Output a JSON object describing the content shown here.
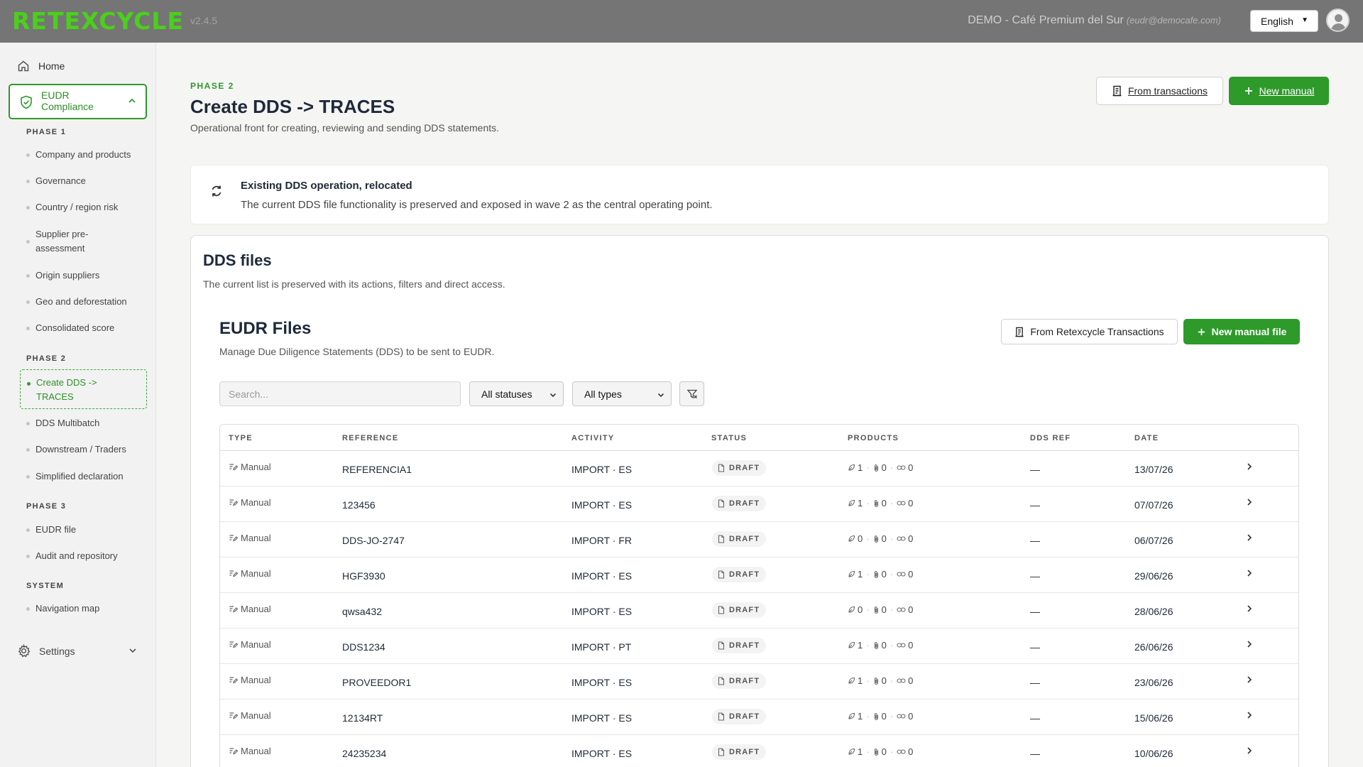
{
  "topbar": {
    "logo": "RETEXCYCLE",
    "version": "v2.4.5",
    "tenant": "DEMO - Café Premium del Sur",
    "email": "(eudr@democafe.com)",
    "language": "English"
  },
  "sidebar": {
    "home": "Home",
    "eudr": "EUDR Compliance",
    "phase1": {
      "title": "PHASE 1",
      "items": [
        "Company and products",
        "Governance",
        "Country / region risk",
        "Supplier pre-assessment",
        "Origin suppliers",
        "Geo and deforestation",
        "Consolidated score"
      ]
    },
    "phase2": {
      "title": "PHASE 2",
      "items": [
        "Create DDS -> TRACES",
        "DDS Multibatch",
        "Downstream / Traders",
        "Simplified declaration"
      ]
    },
    "phase3": {
      "title": "PHASE 3",
      "items": [
        "EUDR file",
        "Audit and repository"
      ]
    },
    "system": {
      "title": "SYSTEM",
      "items": [
        "Navigation map"
      ]
    },
    "settings": "Settings"
  },
  "header": {
    "phase": "PHASE 2",
    "title": "Create DDS -> TRACES",
    "subtitle": "Operational front for creating, reviewing and sending DDS statements.",
    "btn_transactions": "From transactions",
    "btn_new_manual": "New manual"
  },
  "notice": {
    "title": "Existing DDS operation, relocated",
    "text": "The current DDS file functionality is preserved and exposed in wave 2 as the central operating point."
  },
  "dds_card": {
    "title": "DDS files",
    "subtitle": "The current list is preserved with its actions, filters and direct access."
  },
  "files": {
    "title": "EUDR Files",
    "subtitle": "Manage Due Diligence Statements (DDS) to be sent to EUDR.",
    "btn_retexcycle": "From Retexcycle Transactions",
    "btn_new_file": "New manual file",
    "search_placeholder": "Search...",
    "status_filter": "All statuses",
    "type_filter": "All types"
  },
  "table": {
    "headers": [
      "TYPE",
      "REFERENCE",
      "ACTIVITY",
      "STATUS",
      "PRODUCTS",
      "DDS REF",
      "DATE"
    ],
    "rows": [
      {
        "type": "Manual",
        "reference": "REFERENCIA1",
        "activity": "IMPORT · ES",
        "status": "DRAFT",
        "p1": "1",
        "p2": "0",
        "p3": "0",
        "dds_ref": "—",
        "date": "13/07/26"
      },
      {
        "type": "Manual",
        "reference": "123456",
        "activity": "IMPORT · ES",
        "status": "DRAFT",
        "p1": "1",
        "p2": "0",
        "p3": "0",
        "dds_ref": "—",
        "date": "07/07/26"
      },
      {
        "type": "Manual",
        "reference": "DDS-JO-2747",
        "activity": "IMPORT · FR",
        "status": "DRAFT",
        "p1": "0",
        "p2": "0",
        "p3": "0",
        "dds_ref": "—",
        "date": "06/07/26"
      },
      {
        "type": "Manual",
        "reference": "HGF3930",
        "activity": "IMPORT · ES",
        "status": "DRAFT",
        "p1": "1",
        "p2": "0",
        "p3": "0",
        "dds_ref": "—",
        "date": "29/06/26"
      },
      {
        "type": "Manual",
        "reference": "qwsa432",
        "activity": "IMPORT · ES",
        "status": "DRAFT",
        "p1": "0",
        "p2": "0",
        "p3": "0",
        "dds_ref": "—",
        "date": "28/06/26"
      },
      {
        "type": "Manual",
        "reference": "DDS1234",
        "activity": "IMPORT · PT",
        "status": "DRAFT",
        "p1": "1",
        "p2": "0",
        "p3": "0",
        "dds_ref": "—",
        "date": "26/06/26"
      },
      {
        "type": "Manual",
        "reference": "PROVEEDOR1",
        "activity": "IMPORT · ES",
        "status": "DRAFT",
        "p1": "1",
        "p2": "0",
        "p3": "0",
        "dds_ref": "—",
        "date": "23/06/26"
      },
      {
        "type": "Manual",
        "reference": "12134RT",
        "activity": "IMPORT · ES",
        "status": "DRAFT",
        "p1": "1",
        "p2": "0",
        "p3": "0",
        "dds_ref": "—",
        "date": "15/06/26"
      },
      {
        "type": "Manual",
        "reference": "24235234",
        "activity": "IMPORT · ES",
        "status": "DRAFT",
        "p1": "1",
        "p2": "0",
        "p3": "0",
        "dds_ref": "—",
        "date": "10/06/26"
      }
    ]
  },
  "colors": {
    "accent": "#2e9a2a",
    "topbar": "#757575",
    "logo": "#4ad01a"
  },
  "icons": [
    "home-icon",
    "shield-check-icon",
    "chevron-up-icon",
    "gear-icon",
    "chevron-down-icon",
    "receipt-icon",
    "plus-icon",
    "refresh-icon",
    "filter-clear-icon",
    "edit-doc-icon",
    "file-icon",
    "leaf-icon",
    "paperclip-icon",
    "link-icon",
    "chevron-right-icon"
  ]
}
